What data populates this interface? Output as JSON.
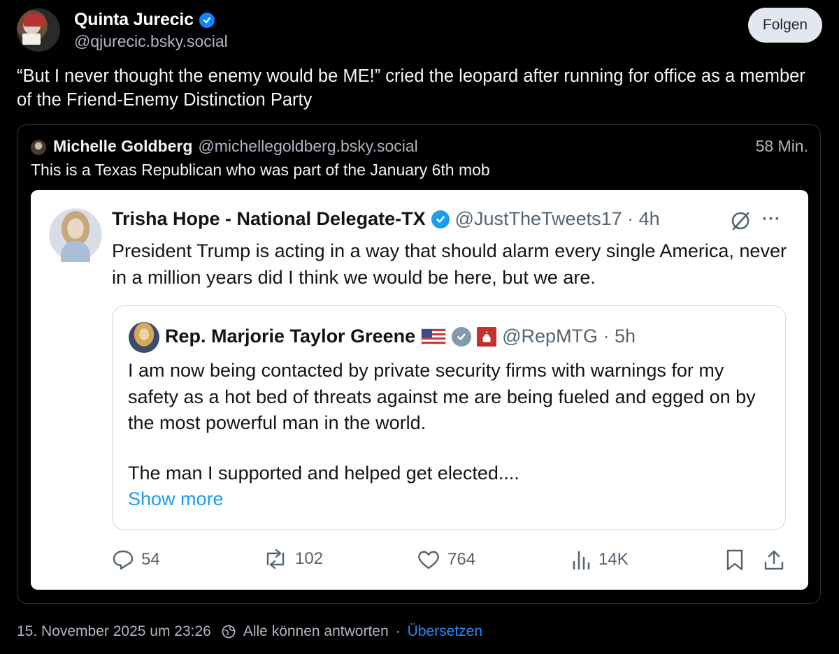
{
  "post": {
    "author_name": "Quinta Jurecic",
    "author_handle": "@qjurecic.bsky.social",
    "follow_label": "Folgen",
    "text": "“But I never thought the enemy would be ME!” cried the leopard after running for office as a member of the Friend-Enemy Distinction Party"
  },
  "quote": {
    "author_name": "Michelle Goldberg",
    "author_handle": "@michellegoldberg.bsky.social",
    "time": "58 Min.",
    "text": "This is a Texas Republican who was part of the January 6th mob"
  },
  "tweet": {
    "author_name": "Trisha Hope - National Delegate-TX",
    "handle_time": "@JustTheTweets17 · 4h",
    "more": "···",
    "text": "President Trump is acting in a way that should alarm every single America, never in a million years did I think we would be here, but we are.",
    "quoted": {
      "author_name": "Rep. Marjorie Taylor Greene",
      "handle_time": "@RepMTG · 5h",
      "text": "I am now being contacted by private security firms with warnings for my safety as a hot bed of threats against me are being fueled and egged on by the most powerful man in the world.",
      "text2": "The man I supported and helped get elected....",
      "show_more": "Show more"
    },
    "actions": {
      "replies": "54",
      "reposts": "102",
      "likes": "764",
      "views": "14K"
    }
  },
  "footer": {
    "timestamp": "15. November 2025 um 23:26",
    "reply_setting": "Alle können antworten",
    "separator": "·",
    "translate": "Übersetzen"
  },
  "colors": {
    "background": "#000000",
    "bluesky_blue": "#1185fe",
    "link_blue": "#208bfe",
    "twitter_blue": "#1d9bf0",
    "muted": "#aeb6c1"
  }
}
